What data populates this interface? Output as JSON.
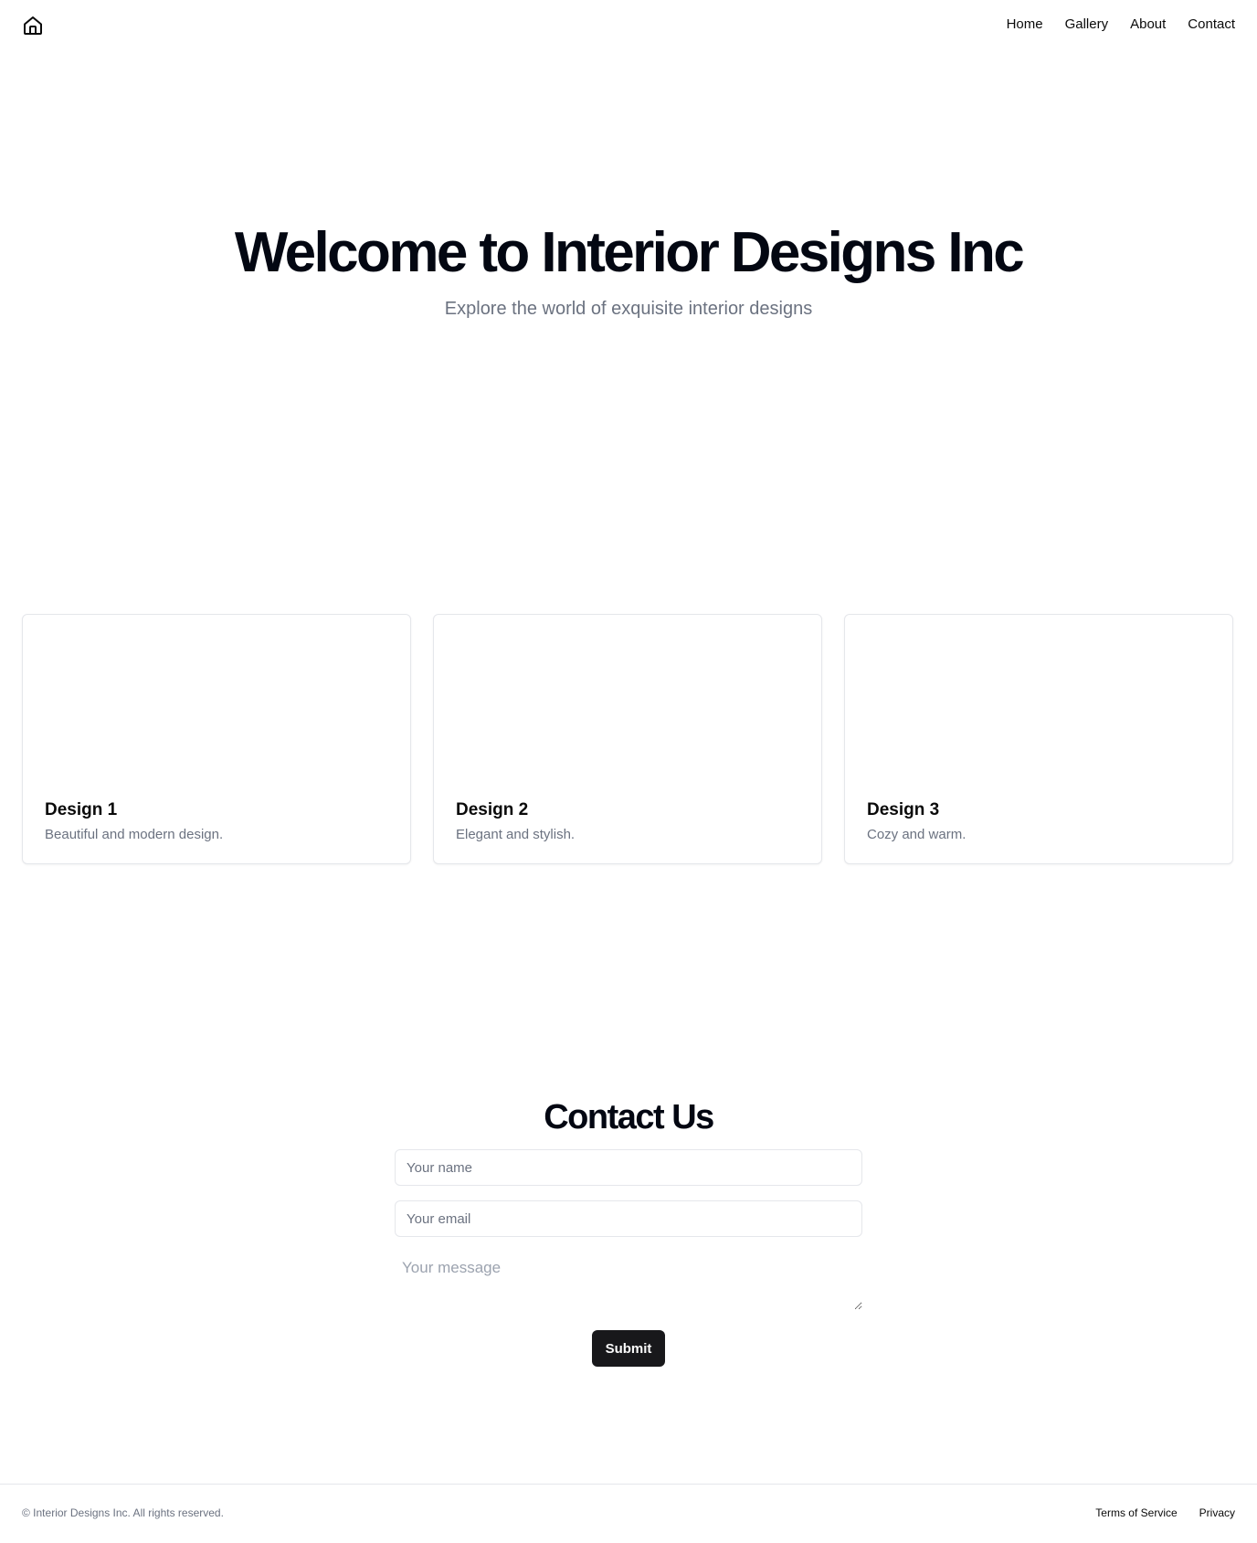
{
  "header": {
    "logo_icon": "home-icon",
    "nav": [
      {
        "label": "Home"
      },
      {
        "label": "Gallery"
      },
      {
        "label": "About"
      },
      {
        "label": "Contact"
      }
    ]
  },
  "hero": {
    "title": "Welcome to Interior Designs Inc",
    "subtitle": "Explore the world of exquisite interior designs"
  },
  "gallery": {
    "cards": [
      {
        "title": "Design 1",
        "description": "Beautiful and modern design."
      },
      {
        "title": "Design 2",
        "description": "Elegant and stylish."
      },
      {
        "title": "Design 3",
        "description": "Cozy and warm."
      }
    ]
  },
  "contact": {
    "title": "Contact Us",
    "name_placeholder": "Your name",
    "email_placeholder": "Your email",
    "message_placeholder": "Your message",
    "submit_label": "Submit"
  },
  "footer": {
    "copyright": "© Interior Designs Inc. All rights reserved.",
    "links": [
      {
        "label": "Terms of Service"
      },
      {
        "label": "Privacy"
      }
    ]
  },
  "colors": {
    "text": "#0a0a0a",
    "muted": "#6b7280",
    "border": "#e5e7eb",
    "button": "#18181b"
  }
}
